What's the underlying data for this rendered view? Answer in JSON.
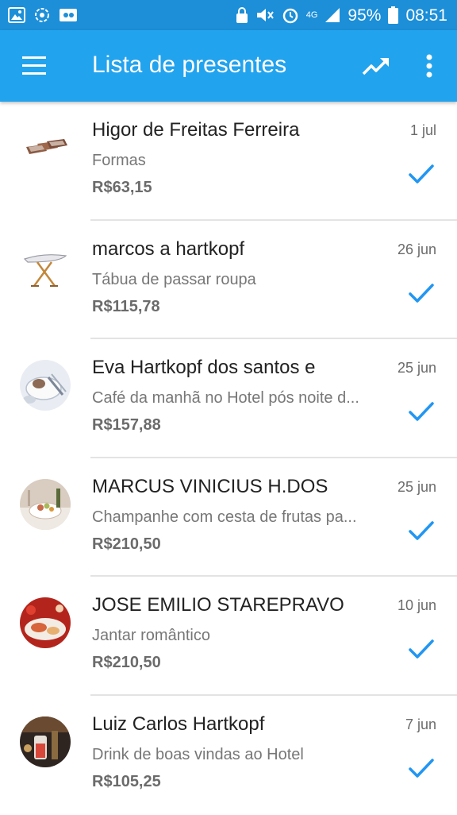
{
  "status_bar": {
    "battery": "95%",
    "time": "08:51",
    "network": "4G",
    "icons": [
      "gallery-icon",
      "sync-icon",
      "cast-icon",
      "lock-icon",
      "mute-icon",
      "alarm-icon",
      "signal-icon",
      "battery-icon"
    ]
  },
  "app_bar": {
    "title": "Lista de presentes",
    "icons": [
      "menu-icon",
      "trending-up-icon",
      "more-vert-icon"
    ]
  },
  "colors": {
    "status_bar": "#1c8fd8",
    "app_bar": "#22a3ee",
    "check": "#2196f3"
  },
  "gifts": [
    {
      "name": "Higor de Freitas Ferreira",
      "date": "1 jul",
      "description": "Formas",
      "price": "R$63,15",
      "image": "baking-pans-image"
    },
    {
      "name": "marcos a hartkopf",
      "date": "26 jun",
      "description": "Tábua de passar roupa",
      "price": "R$115,78",
      "image": "ironing-board-image"
    },
    {
      "name": "Eva Hartkopf dos santos e",
      "date": "25 jun",
      "description": "Café da manhã no Hotel pós noite d...",
      "price": "R$157,88",
      "image": "breakfast-image"
    },
    {
      "name": "MARCUS VINICIUS H.DOS",
      "date": "25 jun",
      "description": "Champanhe com cesta de frutas pa...",
      "price": "R$210,50",
      "image": "champagne-fruit-basket-image"
    },
    {
      "name": "JOSE EMILIO STAREPRAVO",
      "date": "10 jun",
      "description": "Jantar romântico",
      "price": "R$210,50",
      "image": "romantic-dinner-image"
    },
    {
      "name": "Luiz Carlos Hartkopf",
      "date": "7 jun",
      "description": "Drink de boas vindas ao Hotel",
      "price": "R$105,25",
      "image": "welcome-drink-image"
    }
  ]
}
